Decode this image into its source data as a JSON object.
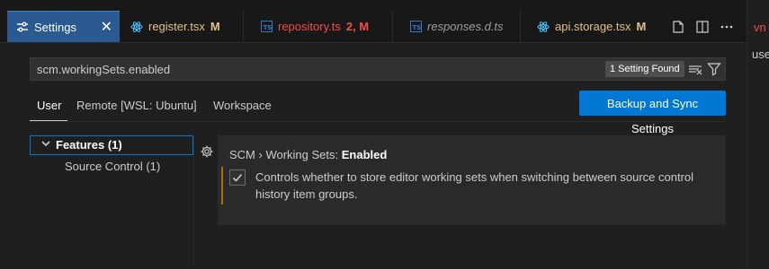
{
  "tabs": [
    {
      "label": "Settings",
      "icon": "settings-icon",
      "active": true
    },
    {
      "label": "register.tsx",
      "modifier": "M",
      "icon": "react-icon"
    },
    {
      "label": "repository.ts",
      "modifier": "2, M",
      "icon": "typescript-icon"
    },
    {
      "label": "responses.d.ts",
      "icon": "typescript-icon"
    },
    {
      "label": "api.storage.tsx",
      "modifier": "M",
      "icon": "react-icon"
    }
  ],
  "toolbar": {
    "split_icon": "split-editor-icon",
    "layout_icon": "layout-icon",
    "more_icon": "more-icon"
  },
  "side_panel": {
    "tab_label": "vn",
    "text": "use"
  },
  "search": {
    "value": "scm.workingSets.enabled",
    "found_label": "1 Setting Found"
  },
  "scopes": [
    "User",
    "Remote [WSL: Ubuntu]",
    "Workspace"
  ],
  "sync_button": "Backup and Sync Settings",
  "toc": {
    "features": "Features",
    "features_count": "(1)",
    "source_control": "Source Control (1)"
  },
  "setting": {
    "category": "SCM › Working Sets: ",
    "name": "Enabled",
    "description": "Controls whether to store editor working sets when switching between source control history item groups.",
    "checked": true
  },
  "colors": {
    "accent": "#0078d4",
    "active_tab": "#2b5a93",
    "modified": "#e2c08d",
    "error": "#f14c4c",
    "react": "#4fc1ff",
    "typescript": "#3178c6"
  }
}
